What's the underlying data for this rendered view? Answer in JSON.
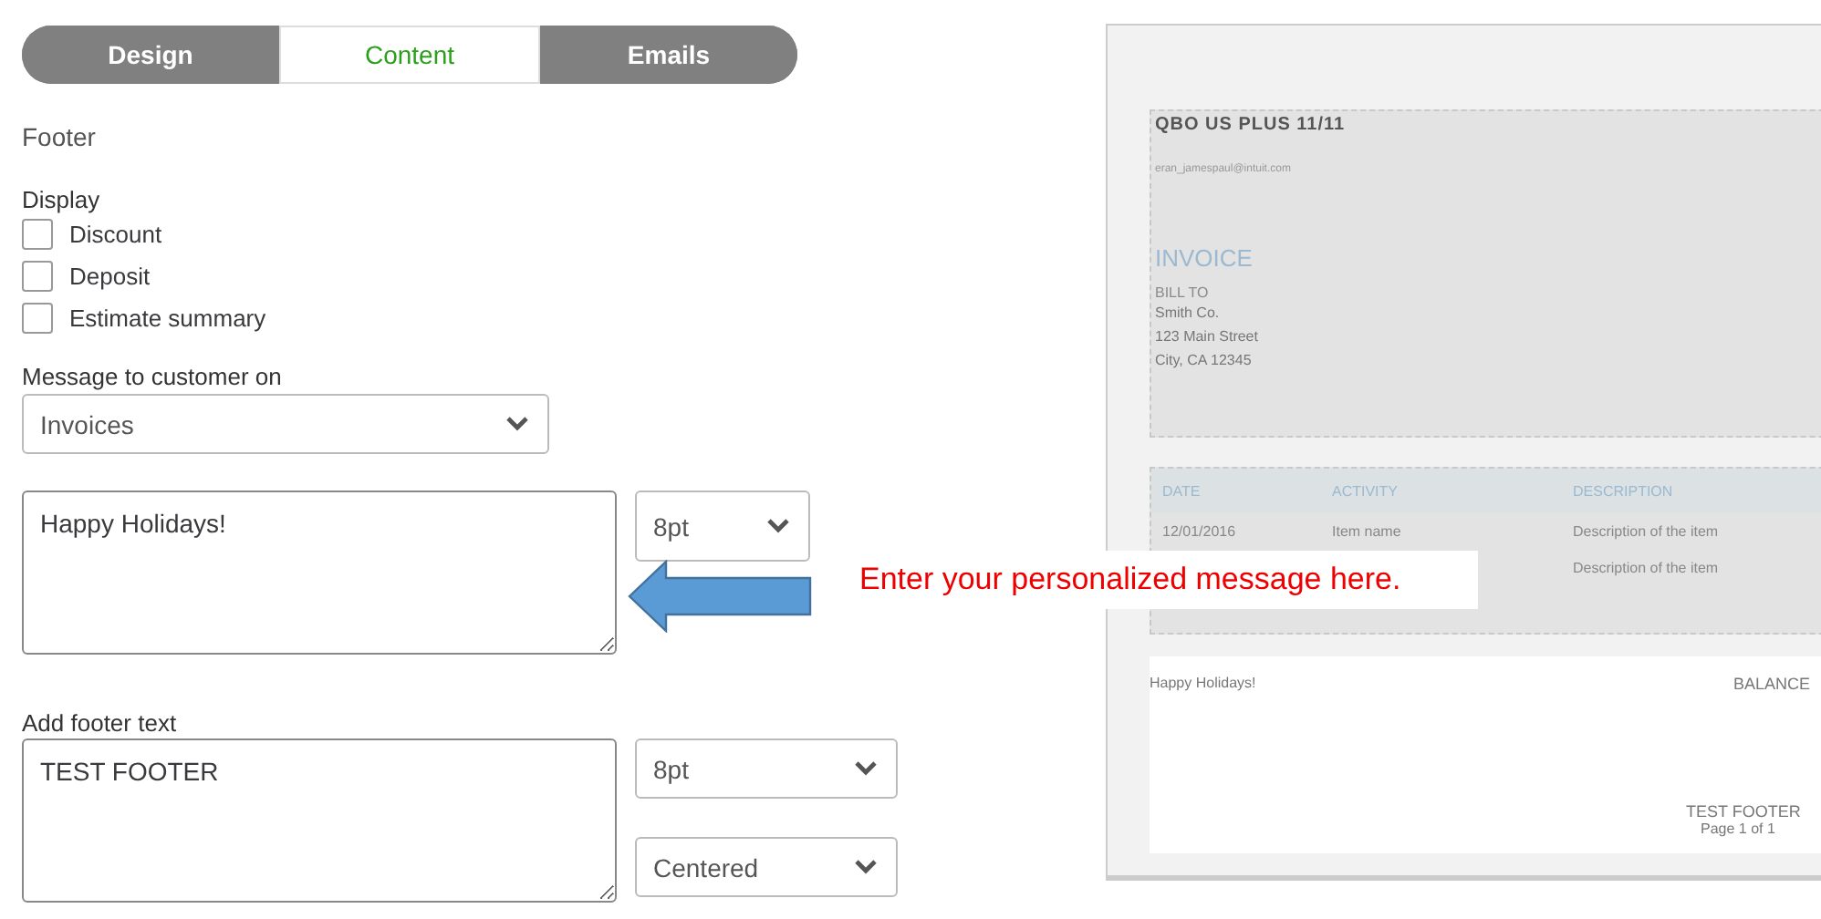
{
  "tabs": [
    {
      "label": "Design",
      "selected": false
    },
    {
      "label": "Content",
      "selected": true
    },
    {
      "label": "Emails",
      "selected": false
    }
  ],
  "section_title": "Footer",
  "display": {
    "label": "Display",
    "options": [
      {
        "label": "Discount",
        "checked": false
      },
      {
        "label": "Deposit",
        "checked": false
      },
      {
        "label": "Estimate summary",
        "checked": false
      }
    ]
  },
  "message": {
    "label": "Message to customer on",
    "on": "Invoices",
    "text": "Happy Holidays!",
    "size": "8pt"
  },
  "footer": {
    "label": "Add footer text",
    "text": "TEST FOOTER",
    "size": "8pt",
    "alignment": "Centered"
  },
  "callout": {
    "text": "Enter your personalized message here."
  },
  "preview": {
    "company": "QBO US PLUS 11/11",
    "email": "eran_jamespaul@intuit.com",
    "title": "INVOICE",
    "bill_to_label": "BILL TO",
    "address": [
      "Smith Co.",
      "123 Main Street",
      "City, CA 12345"
    ],
    "columns": [
      "DATE",
      "ACTIVITY",
      "DESCRIPTION"
    ],
    "rows": [
      {
        "date": "12/01/2016",
        "activity": "Item name",
        "description": "Description of the item"
      },
      {
        "description": "Description of the item"
      }
    ],
    "message": "Happy Holidays!",
    "balance": "BALANCE",
    "footer_text": "TEST FOOTER",
    "page": "Page 1 of 1"
  }
}
